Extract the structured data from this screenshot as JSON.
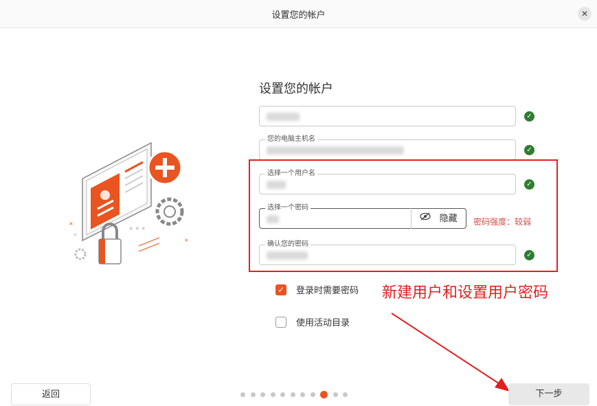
{
  "window": {
    "title": "设置您的帐户",
    "close_glyph": "✕"
  },
  "form": {
    "heading": "设置您的帐户",
    "fields": [
      {
        "label": "",
        "value": "",
        "status": "ok"
      },
      {
        "label": "您的电脑主机名",
        "value": "",
        "status": "ok"
      },
      {
        "label": "选择一个用户名",
        "value": "",
        "status": "ok"
      },
      {
        "label": "选择一个密码",
        "value": "",
        "toggle_label": "隐藏",
        "strength": "密码强度：较弱"
      },
      {
        "label": "确认您的密码",
        "value": "",
        "status": "ok"
      }
    ],
    "checkboxes": [
      {
        "label": "登录时需要密码",
        "checked": true
      },
      {
        "label": "使用活动目录",
        "checked": false
      }
    ]
  },
  "annotation": {
    "text": "新建用户和设置用户密码",
    "color": "#e02020"
  },
  "nav": {
    "back_label": "返回",
    "next_label": "下一步",
    "steps_total": 11,
    "current_step": 9
  },
  "colors": {
    "accent": "#e95420",
    "ok": "#2e7d32",
    "warning": "#d84a4a"
  },
  "icons": {
    "check": "check-circle-icon",
    "eye": "eye-slash-icon",
    "close": "close-icon"
  }
}
